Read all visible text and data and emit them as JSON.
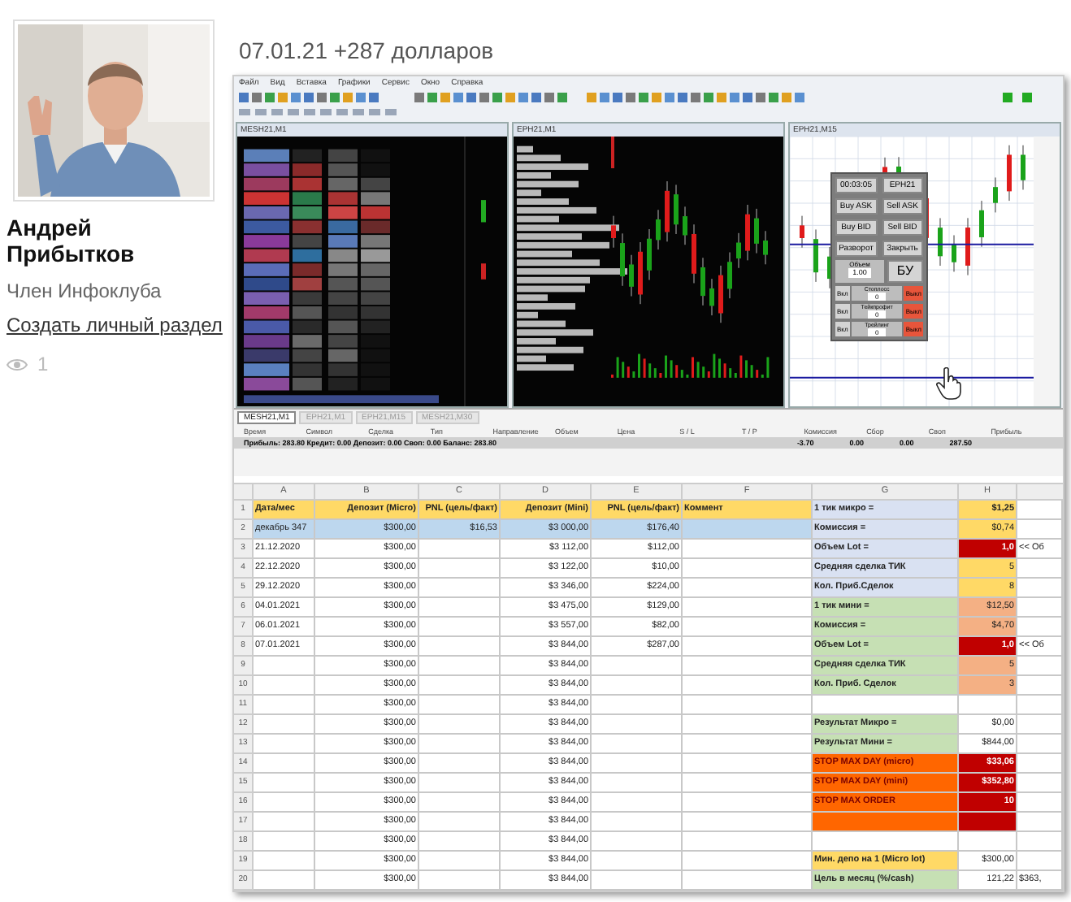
{
  "author": {
    "name": "Андрей Прибытков",
    "role": "Член Инфоклуба",
    "link": "Создать личный раздел",
    "views": "1"
  },
  "post": {
    "title": "07.01.21 +287 долларов"
  },
  "terminal": {
    "menu": [
      "Файл",
      "Вид",
      "Вставка",
      "Графики",
      "Сервис",
      "Окно",
      "Справка"
    ],
    "windows": [
      {
        "title": "MESH21,M1",
        "kind": "footprint"
      },
      {
        "title": "EPH21,M1",
        "kind": "candles"
      },
      {
        "title": "EPH21,M15",
        "kind": "panel"
      }
    ],
    "panel": {
      "timer": "00:03:05",
      "symbol": "EPH21",
      "buttons": [
        "Buy ASK",
        "Sell ASK",
        "Buy BID",
        "Sell BID",
        "Разворот",
        "Закрыть"
      ],
      "volume_label": "Объем",
      "volume": "1.00",
      "breakeven": "БУ",
      "rows": [
        {
          "on": "Вкл",
          "label": "Стоплосс",
          "value": "0",
          "off": "Выкл"
        },
        {
          "on": "Вкл",
          "label": "Тейкпрофит",
          "value": "0",
          "off": "Выкл"
        },
        {
          "on": "Вкл",
          "label": "Трейлинг",
          "value": "0",
          "off": "Выкл"
        }
      ]
    },
    "tabs": [
      {
        "label": "MESH21,M1",
        "selected": true
      },
      {
        "label": "EPH21,M1",
        "selected": false
      },
      {
        "label": "EPH21,M15",
        "selected": false
      },
      {
        "label": "MESH21,M30",
        "selected": false
      }
    ],
    "trade_columns": [
      "Время",
      "Символ",
      "Сделка",
      "Тип",
      "Направление",
      "Объем",
      "Цена",
      "S / L",
      "T / P",
      "Комиссия",
      "Сбор",
      "Своп",
      "Прибыль"
    ],
    "summary": "Прибыль: 283.80 Кредит: 0.00 Депозит: 0.00 Своп: 0.00 Баланс: 283.80",
    "summary_values": [
      "-3.70",
      "0.00",
      "0.00",
      "287.50"
    ]
  },
  "spreadsheet": {
    "columns": [
      "A",
      "B",
      "C",
      "D",
      "E",
      "F",
      "G",
      "H"
    ],
    "rows": [
      {
        "number": "1",
        "cells": [
          {
            "text": "Дата/мес",
            "color": "#ffd966"
          },
          {
            "text": "Депозит (Micro)",
            "color": "#ffd966"
          },
          {
            "text": "PNL (цель/факт)",
            "color": "#ffd966"
          },
          {
            "text": "Депозит (Mini)",
            "color": "#ffd966"
          },
          {
            "text": "PNL (цель/факт)",
            "color": "#ffd966"
          },
          {
            "text": "Коммент",
            "color": "#ffd966"
          },
          {
            "text": "1 тик микро =",
            "color": "#d9e1f2"
          },
          {
            "text": "$1,25",
            "color": "#ffd966"
          }
        ]
      },
      {
        "number": "2",
        "cells": [
          {
            "text": "декабрь 347",
            "color": "#bdd7ee"
          },
          {
            "text": "$300,00",
            "color": "#bdd7ee"
          },
          {
            "text": "$16,53",
            "color": "#bdd7ee"
          },
          {
            "text": "$3 000,00",
            "color": "#bdd7ee"
          },
          {
            "text": "$176,40",
            "color": "#bdd7ee"
          },
          {
            "color": "#bdd7ee"
          },
          {
            "text": "Комиссия =",
            "color": "#d9e1f2"
          },
          {
            "text": "$0,74",
            "color": "#ffd966"
          }
        ]
      },
      {
        "number": "3",
        "cells": [
          {
            "text": "21.12.2020"
          },
          {
            "text": "$300,00"
          },
          {},
          {
            "text": "$3 112,00"
          },
          {
            "text": "$112,00"
          },
          {},
          {
            "text": "Объем Lot =",
            "color": "#d9e1f2"
          },
          {
            "text": "1,0",
            "color": "#c00000"
          },
          {
            "text": "<< Об"
          }
        ]
      },
      {
        "number": "4",
        "cells": [
          {
            "text": "22.12.2020"
          },
          {
            "text": "$300,00"
          },
          {},
          {
            "text": "$3 122,00"
          },
          {
            "text": "$10,00"
          },
          {},
          {
            "text": "Средняя сделка ТИК",
            "color": "#d9e1f2"
          },
          {
            "text": "5",
            "color": "#ffd966"
          }
        ]
      },
      {
        "number": "5",
        "cells": [
          {
            "text": "29.12.2020"
          },
          {
            "text": "$300,00"
          },
          {},
          {
            "text": "$3 346,00"
          },
          {
            "text": "$224,00"
          },
          {},
          {
            "text": "Кол. Приб.Сделок",
            "color": "#d9e1f2"
          },
          {
            "text": "8",
            "color": "#ffd966"
          }
        ]
      },
      {
        "number": "6",
        "cells": [
          {
            "text": "04.01.2021"
          },
          {
            "text": "$300,00"
          },
          {},
          {
            "text": "$3 475,00"
          },
          {
            "text": "$129,00"
          },
          {},
          {
            "text": "1 тик мини =",
            "color": "#c6e0b4"
          },
          {
            "text": "$12,50",
            "color": "#f4b084"
          }
        ]
      },
      {
        "number": "7",
        "cells": [
          {
            "text": "06.01.2021"
          },
          {
            "text": "$300,00"
          },
          {},
          {
            "text": "$3 557,00"
          },
          {
            "text": "$82,00"
          },
          {},
          {
            "text": "Комиссия =",
            "color": "#c6e0b4"
          },
          {
            "text": "$4,70",
            "color": "#f4b084"
          }
        ]
      },
      {
        "number": "8",
        "cells": [
          {
            "text": "07.01.2021"
          },
          {
            "text": "$300,00"
          },
          {},
          {
            "text": "$3 844,00"
          },
          {
            "text": "$287,00"
          },
          {},
          {
            "text": "Объем Lot =",
            "color": "#c6e0b4"
          },
          {
            "text": "1,0",
            "color": "#c00000"
          },
          {
            "text": "<< Об"
          }
        ]
      },
      {
        "number": "9",
        "cells": [
          {},
          {
            "text": "$300,00"
          },
          {},
          {
            "text": "$3 844,00"
          },
          {},
          {},
          {
            "text": "Средняя сделка ТИК",
            "color": "#c6e0b4"
          },
          {
            "text": "5",
            "color": "#f4b084"
          }
        ]
      },
      {
        "number": "10",
        "cells": [
          {},
          {
            "text": "$300,00"
          },
          {},
          {
            "text": "$3 844,00"
          },
          {},
          {},
          {
            "text": "Кол. Приб. Сделок",
            "color": "#c6e0b4"
          },
          {
            "text": "3",
            "color": "#f4b084"
          }
        ]
      },
      {
        "number": "11",
        "cells": [
          {},
          {
            "text": "$300,00"
          },
          {},
          {
            "text": "$3 844,00"
          }
        ]
      },
      {
        "number": "12",
        "cells": [
          {},
          {
            "text": "$300,00"
          },
          {},
          {
            "text": "$3 844,00"
          },
          {},
          {},
          {
            "text": "Результат Микро =",
            "color": "#c6e0b4"
          },
          {
            "text": "$0,00"
          }
        ]
      },
      {
        "number": "13",
        "cells": [
          {},
          {
            "text": "$300,00"
          },
          {},
          {
            "text": "$3 844,00"
          },
          {},
          {},
          {
            "text": "Результат Мини =",
            "color": "#c6e0b4"
          },
          {
            "text": "$844,00"
          }
        ]
      },
      {
        "number": "14",
        "cells": [
          {},
          {
            "text": "$300,00"
          },
          {},
          {
            "text": "$3 844,00"
          },
          {},
          {},
          {
            "text": "STOP MAX DAY (micro)",
            "color": "#ff6600"
          },
          {
            "text": "$33,06",
            "color": "#c00000"
          }
        ]
      },
      {
        "number": "15",
        "cells": [
          {},
          {
            "text": "$300,00"
          },
          {},
          {
            "text": "$3 844,00"
          },
          {},
          {},
          {
            "text": "STOP MAX DAY (mini)",
            "color": "#ff6600"
          },
          {
            "text": "$352,80",
            "color": "#c00000"
          }
        ]
      },
      {
        "number": "16",
        "cells": [
          {},
          {
            "text": "$300,00"
          },
          {},
          {
            "text": "$3 844,00"
          },
          {},
          {},
          {
            "text": "STOP MAX ORDER",
            "color": "#ff6600"
          },
          {
            "text": "10",
            "color": "#c00000"
          }
        ]
      },
      {
        "number": "17",
        "cells": [
          {},
          {
            "text": "$300,00"
          },
          {},
          {
            "text": "$3 844,00"
          },
          {},
          {},
          {
            "color": "#ff6600"
          },
          {
            "color": "#c00000"
          }
        ]
      },
      {
        "number": "18",
        "cells": [
          {},
          {
            "text": "$300,00"
          },
          {},
          {
            "text": "$3 844,00"
          }
        ]
      },
      {
        "number": "19",
        "cells": [
          {},
          {
            "text": "$300,00"
          },
          {},
          {
            "text": "$3 844,00"
          },
          {},
          {},
          {
            "text": "Мин. депо на 1 (Micro lot)",
            "color": "#ffd966"
          },
          {
            "text": "$300,00"
          }
        ]
      },
      {
        "number": "20",
        "cells": [
          {},
          {
            "text": "$300,00"
          },
          {},
          {
            "text": "$3 844,00"
          },
          {},
          {},
          {
            "text": "Цель в месяц (%/cash)",
            "color": "#c6e0b4"
          },
          {
            "text": "121,22"
          },
          {
            "text": "$363,"
          }
        ]
      }
    ]
  }
}
